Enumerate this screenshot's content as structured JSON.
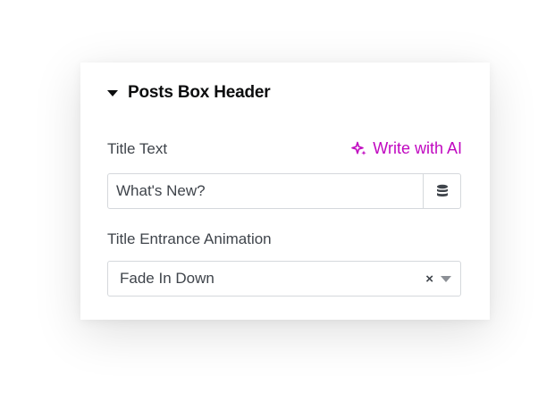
{
  "section": {
    "title": "Posts Box Header"
  },
  "title_text": {
    "label": "Title Text",
    "value": "What's New?",
    "ai_link_label": "Write with AI"
  },
  "title_animation": {
    "label": "Title Entrance Animation",
    "selected": "Fade In Down"
  },
  "colors": {
    "ai_accent": "#c008c0",
    "label_text": "#3f444b",
    "border": "#d5d8dc"
  },
  "icons": {
    "section_toggle": "caret-down-icon",
    "ai": "sparkle-icon",
    "dynamic_tags": "database-icon",
    "clear": "clear-x-icon",
    "select_arrow": "chevron-down-icon"
  }
}
